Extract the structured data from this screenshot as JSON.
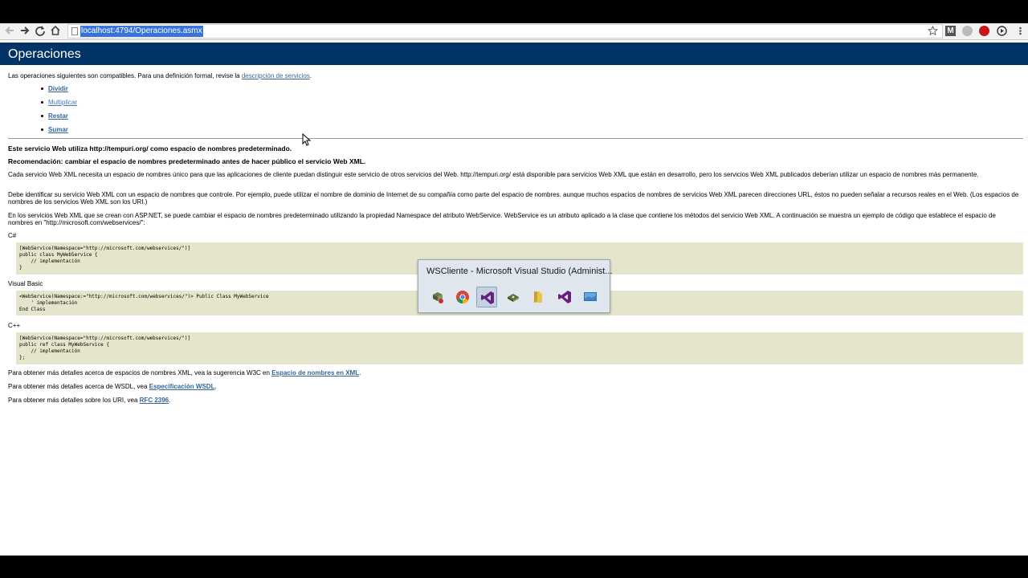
{
  "browser": {
    "url": "localhost:4794/Operaciones.asmx",
    "back_icon": "arrow-left-icon",
    "forward_icon": "arrow-right-icon",
    "reload_icon": "reload-icon",
    "home_icon": "home-icon",
    "star_icon": "star-icon",
    "menu_icon": "menu-icon"
  },
  "page": {
    "title": "Operaciones",
    "intro": "Las operaciones siguientes son compatibles. Para una definición formal, revise la",
    "intro_link": "descripción de servicios",
    "intro_end": ".",
    "operations": [
      "Dividir",
      "Multiplicar",
      "Restar",
      "Sumar"
    ],
    "namespace_notice": "Este servicio Web utiliza http://tempuri.org/ como espacio de nombres predeterminado.",
    "recommendation": "Recomendación: cambiar el espacio de nombres predeterminado antes de hacer público el servicio Web XML.",
    "para1": "Cada servicio Web XML necesita un espacio de nombres único para que las aplicaciones de cliente puedan distinguir este servicio de otros servicios del Web. http://tempuri.org/ está disponible para servicios Web XML que están en desarrollo, pero los servicios Web XML publicados deberían utilizar un espacio de nombres más permanente.",
    "para2": "Debe identificar su servicio Web XML con un espacio de nombres que controle. Por ejemplo, puede utilizar el nombre de dominio de Internet de su compañía como parte del espacio de nombres. aunque muchos espacios de nombres de servicios Web XML parecen direcciones URL, éstos no pueden señalar a recursos reales en el Web. (Los espacios de nombres de los servicios Web XML son los URI.)",
    "para3": "En los servicios Web XML que se crean con ASP.NET, se puede cambiar el espacio de nombres predeterminado utilizando la propiedad Namespace del atributo WebService. WebService es un atributo aplicado a la clase que contiene los métodos del servicio Web XML. A continuación se muestra un ejemplo de código que establece el espacio de nombres en \"http://microsoft.com/webservices/\":",
    "lang_cs": "C#",
    "code_cs": "[WebService(Namespace=\"http://microsoft.com/webservices/\")]\npublic class MyWebService {\n    // implementación\n}",
    "lang_vb": "Visual Basic",
    "code_vb": "<WebService(Namespace:=\"http://microsoft.com/webservices/\")> Public Class MyWebService\n    ' implementación\nEnd Class",
    "lang_cpp": "C++",
    "code_cpp": "[WebService(Namespace=\"http://microsoft.com/webservices/\")]\npublic ref class MyWebService {\n    // implementación\n};",
    "more_xml": "Para obtener más detalles acerca de espacios de nombres XML, vea la sugerencia W3C en",
    "more_xml_link": "Espacio de nombres en XML",
    "more_wsdl": "Para obtener más detalles acerca de WSDL, vea",
    "more_wsdl_link": "Especificación WSDL",
    "more_uri": "Para obtener más detalles sobre los URI, vea",
    "more_uri_link": "RFC 2396",
    "period": "."
  },
  "task_switcher": {
    "title": "WSCliente - Microsoft Visual Studio (Administ...",
    "icons": [
      "server-explorer-icon",
      "chrome-icon",
      "visual-studio-icon",
      "server-manager-icon",
      "folder-icon",
      "visual-studio-icon",
      "desktop-icon"
    ]
  },
  "colors": {
    "header_bg": "#003366",
    "link": "#336699",
    "code_bg": "#e5e5cc",
    "url_highlight": "#3874d8"
  }
}
